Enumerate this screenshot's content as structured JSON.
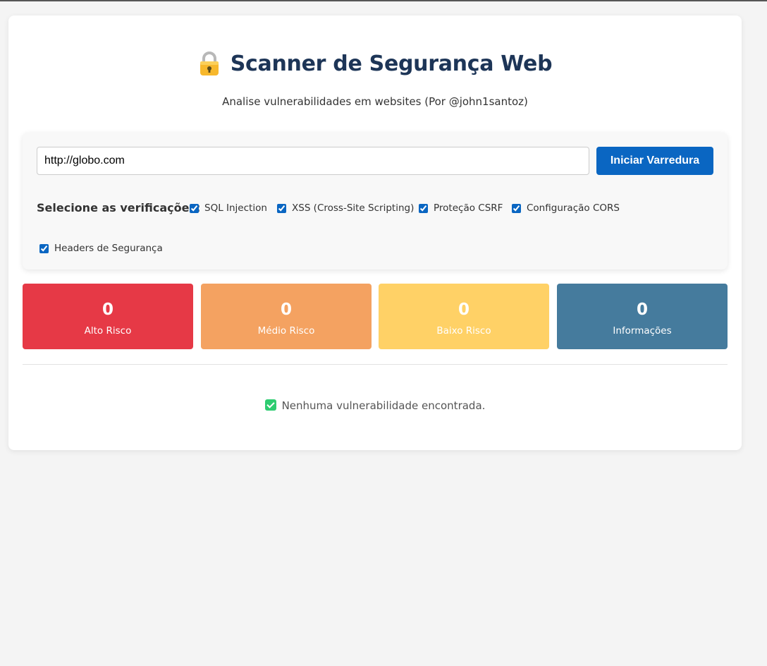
{
  "header": {
    "title": "Scanner de Segurança Web",
    "title_icon": "lock-icon",
    "subtitle": "Analise vulnerabilidades em websites (Por @john1santoz)"
  },
  "scan": {
    "url_value": "http://globo.com",
    "button_label": "Iniciar Varredura"
  },
  "checks": {
    "label": "Selecione as verificações:",
    "items": [
      {
        "label": "SQL Injection",
        "checked": true
      },
      {
        "label": "XSS (Cross-Site Scripting)",
        "checked": true
      },
      {
        "label": "Proteção CSRF",
        "checked": true
      },
      {
        "label": "Configuração CORS",
        "checked": true
      },
      {
        "label": "Headers de Segurança",
        "checked": true
      }
    ]
  },
  "stats": [
    {
      "value": "0",
      "label": "Alto Risco",
      "color": "#e63946"
    },
    {
      "value": "0",
      "label": "Médio Risco",
      "color": "#f4a261"
    },
    {
      "value": "0",
      "label": "Baixo Risco",
      "color": "#ffd166"
    },
    {
      "value": "0",
      "label": "Informações",
      "color": "#457b9d"
    }
  ],
  "result": {
    "icon": "check-icon",
    "message": "Nenhuma vulnerabilidade encontrada."
  }
}
